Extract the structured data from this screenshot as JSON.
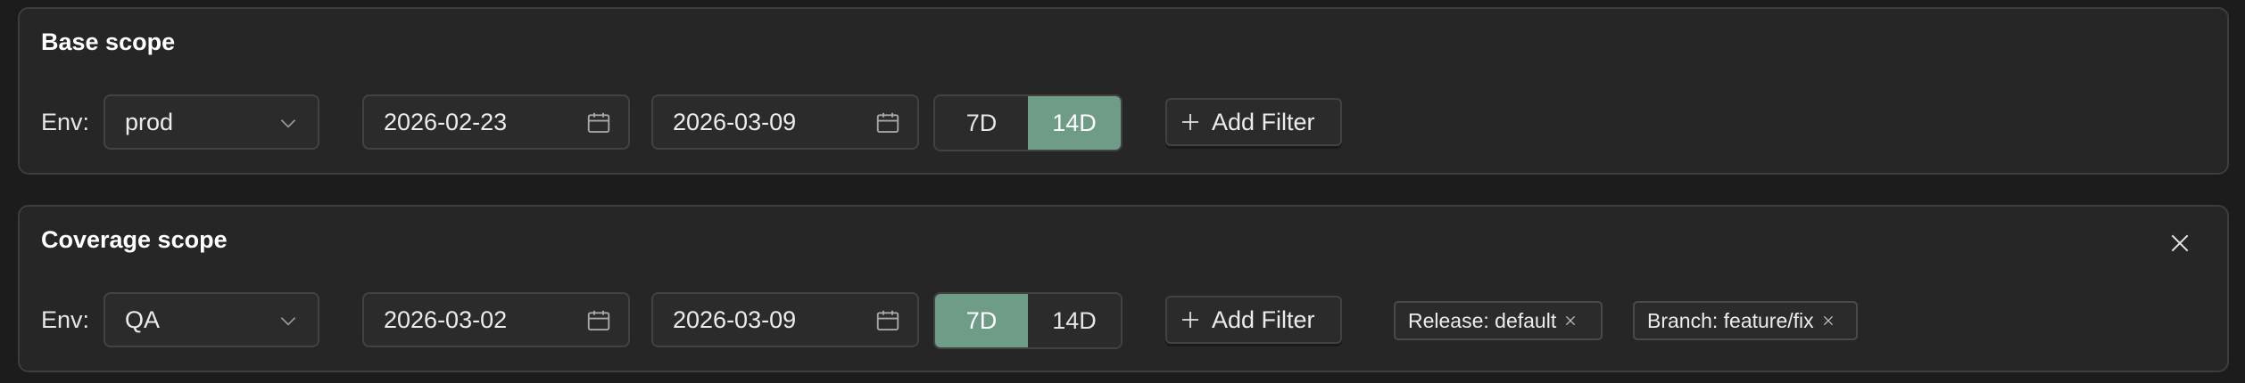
{
  "base_scope": {
    "title": "Base scope",
    "env_label": "Env:",
    "env_value": "prod",
    "start_date": "2026-02-23",
    "end_date": "2026-03-09",
    "range_options": [
      "7D",
      "14D"
    ],
    "active_range": "14D",
    "add_filter_label": "Add Filter"
  },
  "coverage_scope": {
    "title": "Coverage scope",
    "env_label": "Env:",
    "env_value": "QA",
    "start_date": "2026-03-02",
    "end_date": "2026-03-09",
    "range_options": [
      "7D",
      "14D"
    ],
    "active_range": "7D",
    "add_filter_label": "Add Filter",
    "filters": [
      "Release: default",
      "Branch: feature/fix"
    ]
  },
  "icons": {
    "select": "chevron-down-icon",
    "date": "calendar-icon",
    "add": "plus-icon",
    "remove": "close-icon"
  },
  "colors": {
    "active_segment": "#6e9c87",
    "panel_bg": "#262626",
    "page_bg": "#1c1c1c"
  }
}
